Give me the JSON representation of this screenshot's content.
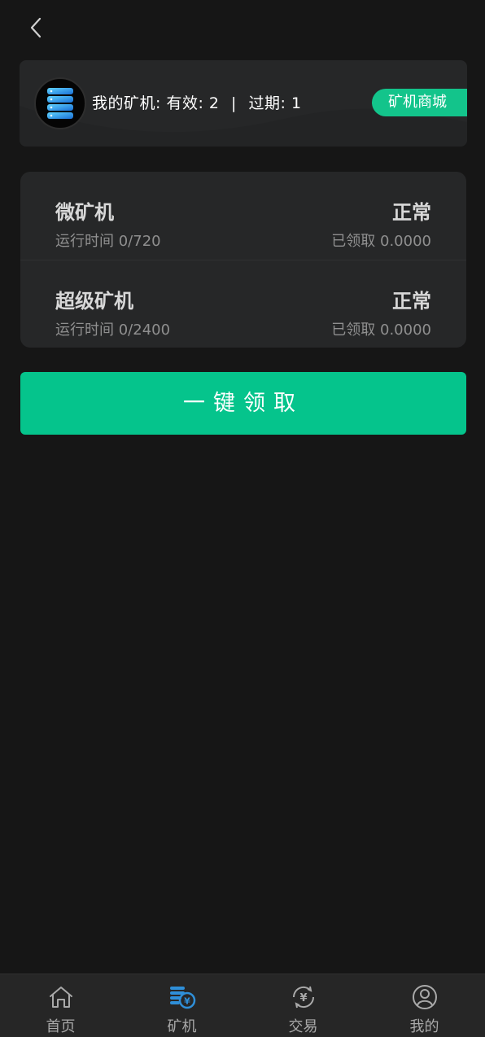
{
  "summary": {
    "label": "我的矿机:",
    "valid_label": "有效:",
    "valid_count": "2",
    "separator": "|",
    "expired_label": "过期:",
    "expired_count": "1",
    "mall_button": "矿机商城"
  },
  "miners": [
    {
      "name": "微矿机",
      "status": "正常",
      "runtime": "运行时间 0/720",
      "claimed": "已领取 0.0000"
    },
    {
      "name": "超级矿机",
      "status": "正常",
      "runtime": "运行时间 0/2400",
      "claimed": "已领取 0.0000"
    }
  ],
  "claim_button": "一键领取",
  "tabs": [
    {
      "label": "首页",
      "icon": "home-icon"
    },
    {
      "label": "矿机",
      "icon": "miner-icon",
      "active": true
    },
    {
      "label": "交易",
      "icon": "exchange-icon"
    },
    {
      "label": "我的",
      "icon": "user-icon"
    }
  ],
  "colors": {
    "background": "#161616",
    "card": "#262728",
    "accent": "#05c48c",
    "active_icon": "#2f8fd8"
  }
}
